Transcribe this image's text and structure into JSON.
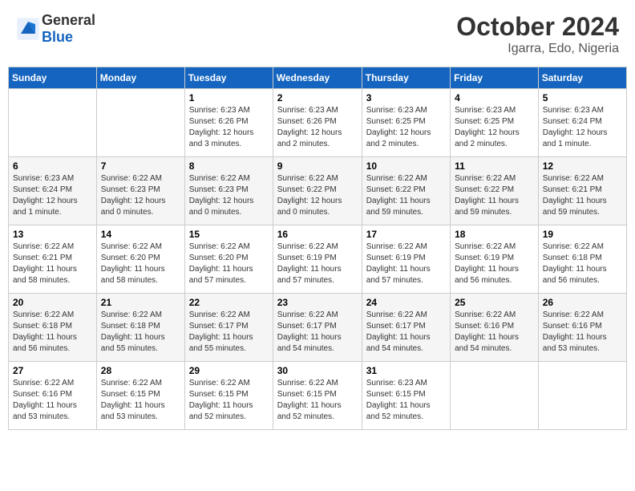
{
  "header": {
    "logo_general": "General",
    "logo_blue": "Blue",
    "month_title": "October 2024",
    "location": "Igarra, Edo, Nigeria"
  },
  "calendar": {
    "columns": [
      "Sunday",
      "Monday",
      "Tuesday",
      "Wednesday",
      "Thursday",
      "Friday",
      "Saturday"
    ],
    "weeks": [
      [
        {
          "day": "",
          "info": ""
        },
        {
          "day": "",
          "info": ""
        },
        {
          "day": "1",
          "info": "Sunrise: 6:23 AM\nSunset: 6:26 PM\nDaylight: 12 hours\nand 3 minutes."
        },
        {
          "day": "2",
          "info": "Sunrise: 6:23 AM\nSunset: 6:26 PM\nDaylight: 12 hours\nand 2 minutes."
        },
        {
          "day": "3",
          "info": "Sunrise: 6:23 AM\nSunset: 6:25 PM\nDaylight: 12 hours\nand 2 minutes."
        },
        {
          "day": "4",
          "info": "Sunrise: 6:23 AM\nSunset: 6:25 PM\nDaylight: 12 hours\nand 2 minutes."
        },
        {
          "day": "5",
          "info": "Sunrise: 6:23 AM\nSunset: 6:24 PM\nDaylight: 12 hours\nand 1 minute."
        }
      ],
      [
        {
          "day": "6",
          "info": "Sunrise: 6:23 AM\nSunset: 6:24 PM\nDaylight: 12 hours\nand 1 minute."
        },
        {
          "day": "7",
          "info": "Sunrise: 6:22 AM\nSunset: 6:23 PM\nDaylight: 12 hours\nand 0 minutes."
        },
        {
          "day": "8",
          "info": "Sunrise: 6:22 AM\nSunset: 6:23 PM\nDaylight: 12 hours\nand 0 minutes."
        },
        {
          "day": "9",
          "info": "Sunrise: 6:22 AM\nSunset: 6:22 PM\nDaylight: 12 hours\nand 0 minutes."
        },
        {
          "day": "10",
          "info": "Sunrise: 6:22 AM\nSunset: 6:22 PM\nDaylight: 11 hours\nand 59 minutes."
        },
        {
          "day": "11",
          "info": "Sunrise: 6:22 AM\nSunset: 6:22 PM\nDaylight: 11 hours\nand 59 minutes."
        },
        {
          "day": "12",
          "info": "Sunrise: 6:22 AM\nSunset: 6:21 PM\nDaylight: 11 hours\nand 59 minutes."
        }
      ],
      [
        {
          "day": "13",
          "info": "Sunrise: 6:22 AM\nSunset: 6:21 PM\nDaylight: 11 hours\nand 58 minutes."
        },
        {
          "day": "14",
          "info": "Sunrise: 6:22 AM\nSunset: 6:20 PM\nDaylight: 11 hours\nand 58 minutes."
        },
        {
          "day": "15",
          "info": "Sunrise: 6:22 AM\nSunset: 6:20 PM\nDaylight: 11 hours\nand 57 minutes."
        },
        {
          "day": "16",
          "info": "Sunrise: 6:22 AM\nSunset: 6:19 PM\nDaylight: 11 hours\nand 57 minutes."
        },
        {
          "day": "17",
          "info": "Sunrise: 6:22 AM\nSunset: 6:19 PM\nDaylight: 11 hours\nand 57 minutes."
        },
        {
          "day": "18",
          "info": "Sunrise: 6:22 AM\nSunset: 6:19 PM\nDaylight: 11 hours\nand 56 minutes."
        },
        {
          "day": "19",
          "info": "Sunrise: 6:22 AM\nSunset: 6:18 PM\nDaylight: 11 hours\nand 56 minutes."
        }
      ],
      [
        {
          "day": "20",
          "info": "Sunrise: 6:22 AM\nSunset: 6:18 PM\nDaylight: 11 hours\nand 56 minutes."
        },
        {
          "day": "21",
          "info": "Sunrise: 6:22 AM\nSunset: 6:18 PM\nDaylight: 11 hours\nand 55 minutes."
        },
        {
          "day": "22",
          "info": "Sunrise: 6:22 AM\nSunset: 6:17 PM\nDaylight: 11 hours\nand 55 minutes."
        },
        {
          "day": "23",
          "info": "Sunrise: 6:22 AM\nSunset: 6:17 PM\nDaylight: 11 hours\nand 54 minutes."
        },
        {
          "day": "24",
          "info": "Sunrise: 6:22 AM\nSunset: 6:17 PM\nDaylight: 11 hours\nand 54 minutes."
        },
        {
          "day": "25",
          "info": "Sunrise: 6:22 AM\nSunset: 6:16 PM\nDaylight: 11 hours\nand 54 minutes."
        },
        {
          "day": "26",
          "info": "Sunrise: 6:22 AM\nSunset: 6:16 PM\nDaylight: 11 hours\nand 53 minutes."
        }
      ],
      [
        {
          "day": "27",
          "info": "Sunrise: 6:22 AM\nSunset: 6:16 PM\nDaylight: 11 hours\nand 53 minutes."
        },
        {
          "day": "28",
          "info": "Sunrise: 6:22 AM\nSunset: 6:15 PM\nDaylight: 11 hours\nand 53 minutes."
        },
        {
          "day": "29",
          "info": "Sunrise: 6:22 AM\nSunset: 6:15 PM\nDaylight: 11 hours\nand 52 minutes."
        },
        {
          "day": "30",
          "info": "Sunrise: 6:22 AM\nSunset: 6:15 PM\nDaylight: 11 hours\nand 52 minutes."
        },
        {
          "day": "31",
          "info": "Sunrise: 6:23 AM\nSunset: 6:15 PM\nDaylight: 11 hours\nand 52 minutes."
        },
        {
          "day": "",
          "info": ""
        },
        {
          "day": "",
          "info": ""
        }
      ]
    ]
  }
}
